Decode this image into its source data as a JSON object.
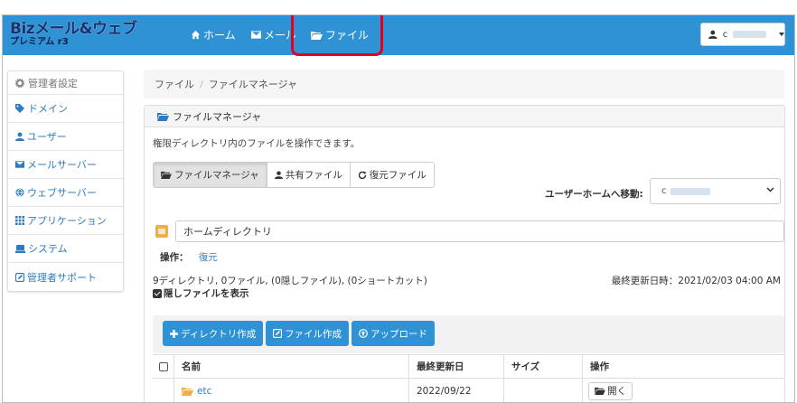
{
  "brand": {
    "line1": "Bizメール&ウェブ",
    "line2": "プレミアム r3"
  },
  "nav": [
    {
      "label": "ホーム",
      "icon": "home-icon"
    },
    {
      "label": "メール",
      "icon": "envelope-icon"
    },
    {
      "label": "ファイル",
      "icon": "folder-open-icon"
    }
  ],
  "user": {
    "prefix": "c",
    "icon": "user-icon"
  },
  "sidebar": {
    "header": "管理者設定",
    "items": [
      {
        "label": "ドメイン",
        "icon": "tag-icon"
      },
      {
        "label": "ユーザー",
        "icon": "user-icon"
      },
      {
        "label": "メールサーバー",
        "icon": "envelope-icon"
      },
      {
        "label": "ウェブサーバー",
        "icon": "globe-icon"
      },
      {
        "label": "アプリケーション",
        "icon": "grid-icon"
      },
      {
        "label": "システム",
        "icon": "drive-icon"
      },
      {
        "label": "管理者サポート",
        "icon": "edit-icon"
      }
    ]
  },
  "breadcrumb": {
    "root": "ファイル",
    "separator": "/",
    "current": "ファイルマネージャ"
  },
  "panel": {
    "title": "ファイルマネージャ",
    "description": "権限ディレクトリ内のファイルを操作できます。",
    "tabs": [
      {
        "label": "ファイルマネージャ",
        "icon": "folder-open-icon"
      },
      {
        "label": "共有ファイル",
        "icon": "user-icon"
      },
      {
        "label": "復元ファイル",
        "icon": "refresh-icon"
      }
    ],
    "move_label": "ユーザーホームへ移動:",
    "move_select_prefix": "c",
    "directory": "ホームディレクトリ",
    "ops_label": "操作：",
    "ops_link": "復元",
    "summary": "9ディレクトリ, 0ファイル, (0隠しファイル), (0ショートカット)",
    "updated": "最終更新日時：2021/02/03 04:00 AM",
    "show_hidden": "隠しファイルを表示"
  },
  "toolbar": {
    "create_dir": "ディレクトリ作成",
    "create_file": "ファイル作成",
    "upload": "アップロード"
  },
  "table": {
    "headers": {
      "name": "名前",
      "updated": "最終更新日",
      "size": "サイズ",
      "action": "操作"
    },
    "rows": [
      {
        "name": "etc",
        "updated": "2022/09/22",
        "size": "",
        "action": "開く"
      }
    ]
  },
  "colors": {
    "navbar": "#2f92d4",
    "highlight": "#e3001b",
    "link": "#2f7bbf"
  }
}
